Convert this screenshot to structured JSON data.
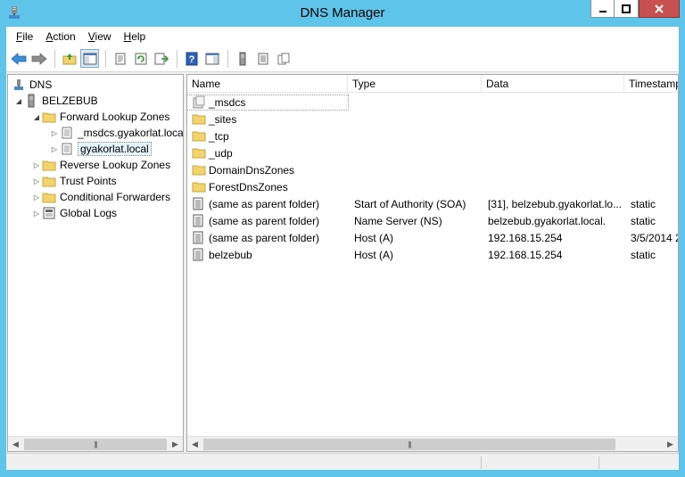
{
  "window": {
    "title": "DNS Manager"
  },
  "menu": [
    {
      "key": "F",
      "rest": "ile"
    },
    {
      "key": "A",
      "rest": "ction"
    },
    {
      "key": "V",
      "rest": "iew"
    },
    {
      "key": "H",
      "rest": "elp"
    }
  ],
  "toolbar": {
    "buttons": [
      "back-arrow-icon",
      "forward-arrow-icon",
      "up-folder-icon",
      "show-hide-console-tree-icon",
      "properties-icon",
      "refresh-icon",
      "export-list-icon",
      "help-icon",
      "action-pane-icon",
      "server-icon",
      "zone-list-icon",
      "copy-icon"
    ]
  },
  "tree": {
    "root": "DNS",
    "server": "BELZEBUB",
    "forward_zones": "Forward Lookup Zones",
    "zone_msdcs": "_msdcs.gyakorlat.local",
    "zone_selected": "gyakorlat.local",
    "reverse_zones": "Reverse Lookup Zones",
    "trust_points": "Trust Points",
    "conditional_forwarders": "Conditional Forwarders",
    "global_logs": "Global Logs"
  },
  "list": {
    "columns": [
      "Name",
      "Type",
      "Data",
      "Timestamp"
    ],
    "rows": [
      {
        "name": "_msdcs",
        "type": "",
        "data": "",
        "timestamp": "",
        "icon": "delegated-folder"
      },
      {
        "name": "_sites",
        "type": "",
        "data": "",
        "timestamp": "",
        "icon": "folder"
      },
      {
        "name": "_tcp",
        "type": "",
        "data": "",
        "timestamp": "",
        "icon": "folder"
      },
      {
        "name": "_udp",
        "type": "",
        "data": "",
        "timestamp": "",
        "icon": "folder"
      },
      {
        "name": "DomainDnsZones",
        "type": "",
        "data": "",
        "timestamp": "",
        "icon": "folder"
      },
      {
        "name": "ForestDnsZones",
        "type": "",
        "data": "",
        "timestamp": "",
        "icon": "folder"
      },
      {
        "name": "(same as parent folder)",
        "type": "Start of Authority (SOA)",
        "data": "[31], belzebub.gyakorlat.lo...",
        "timestamp": "static",
        "icon": "record"
      },
      {
        "name": "(same as parent folder)",
        "type": "Name Server (NS)",
        "data": "belzebub.gyakorlat.local.",
        "timestamp": "static",
        "icon": "record"
      },
      {
        "name": "(same as parent folder)",
        "type": "Host (A)",
        "data": "192.168.15.254",
        "timestamp": "3/5/2014 2",
        "icon": "record"
      },
      {
        "name": "belzebub",
        "type": "Host (A)",
        "data": "192.168.15.254",
        "timestamp": "static",
        "icon": "record"
      }
    ]
  },
  "colors": {
    "titlebar": "#5ec4ea",
    "close_button": "#c75050",
    "folder": "#f3d36b"
  }
}
